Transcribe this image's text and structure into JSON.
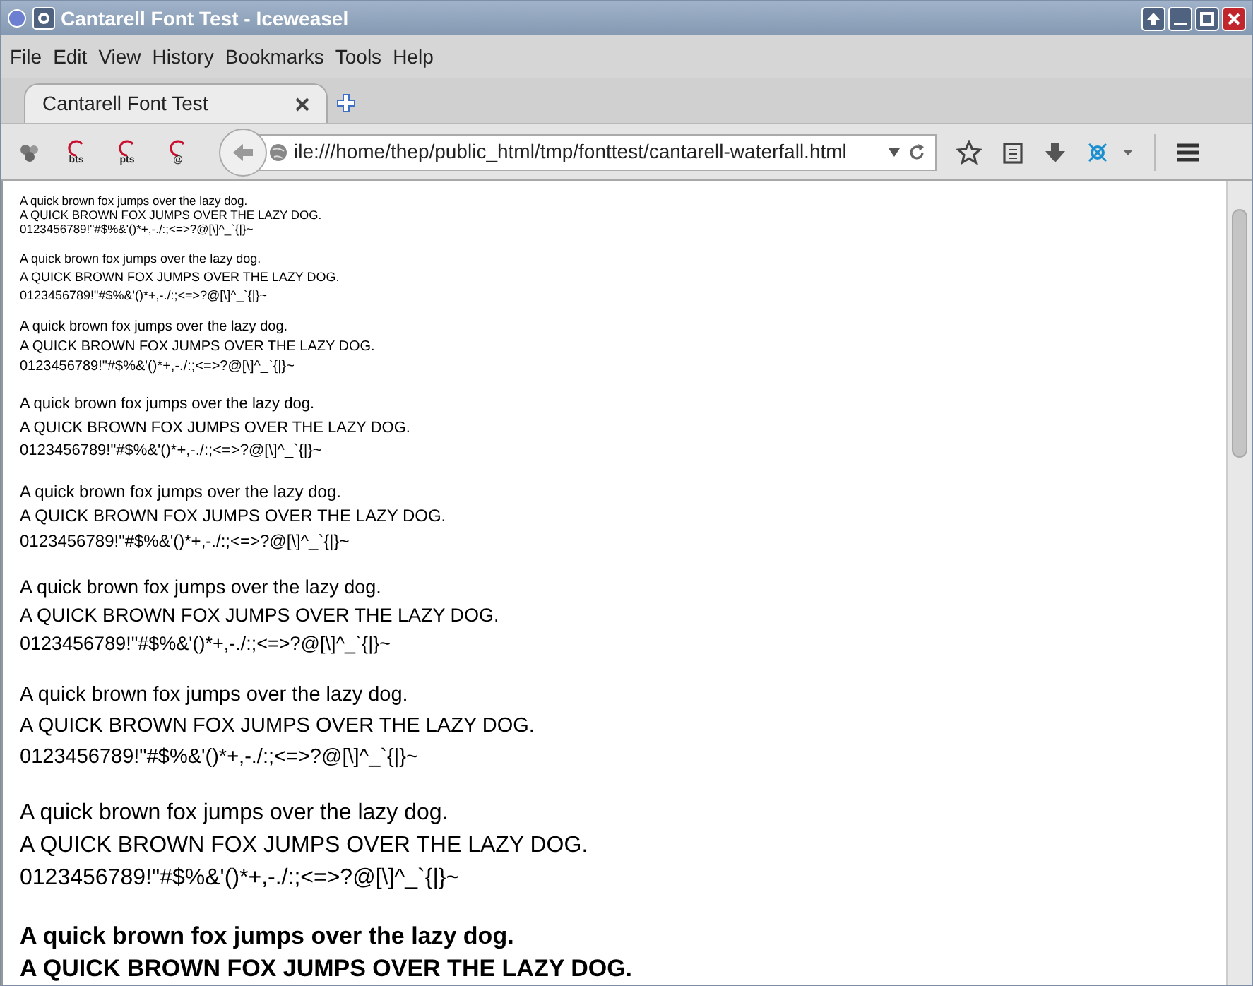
{
  "window": {
    "title": "Cantarell Font Test - Iceweasel"
  },
  "menu": [
    "File",
    "Edit",
    "View",
    "History",
    "Bookmarks",
    "Tools",
    "Help"
  ],
  "tabs": [
    {
      "label": "Cantarell Font Test",
      "selected": true
    }
  ],
  "bookmarks": [
    {
      "kind": "plain"
    },
    {
      "kind": "labeled",
      "label": "bts"
    },
    {
      "kind": "labeled",
      "label": "pts"
    },
    {
      "kind": "labeled",
      "label": "@"
    }
  ],
  "url": {
    "value": "ile:///home/thep/public_html/tmp/fonttest/cantarell-waterfall.html"
  },
  "blocks": [
    {
      "bold": false,
      "lines": [
        "A quick brown fox jumps over the lazy dog.",
        "A QUICK BROWN FOX JUMPS OVER THE LAZY DOG.",
        "0123456789!\"#$%&'()*+,-./:;<=>?@[\\]^_`{|}~"
      ]
    },
    {
      "bold": false,
      "lines": [
        "A quick brown fox jumps over the lazy dog.",
        "A QUICK BROWN FOX JUMPS OVER THE LAZY DOG.",
        "0123456789!\"#$%&'()*+,-./:;<=>?@[\\]^_`{|}~"
      ]
    },
    {
      "bold": false,
      "lines": [
        "A quick brown fox jumps over the lazy dog.",
        "A QUICK BROWN FOX JUMPS OVER THE LAZY DOG.",
        "0123456789!\"#$%&'()*+,-./:;<=>?@[\\]^_`{|}~"
      ]
    },
    {
      "bold": false,
      "lines": [
        "A quick brown fox jumps over the lazy dog.",
        "A QUICK BROWN FOX JUMPS OVER THE LAZY DOG.",
        "0123456789!\"#$%&'()*+,-./:;<=>?@[\\]^_`{|}~"
      ]
    },
    {
      "bold": false,
      "lines": [
        "A quick brown fox jumps over the lazy dog.",
        "A QUICK BROWN FOX JUMPS OVER THE LAZY DOG.",
        "0123456789!\"#$%&'()*+,-./:;<=>?@[\\]^_`{|}~"
      ]
    },
    {
      "bold": false,
      "lines": [
        "A quick brown fox jumps over the lazy dog.",
        "A QUICK BROWN FOX JUMPS OVER THE LAZY DOG.",
        "0123456789!\"#$%&'()*+,-./:;<=>?@[\\]^_`{|}~"
      ]
    },
    {
      "bold": false,
      "lines": [
        "A quick brown fox jumps over the lazy dog.",
        "A QUICK BROWN FOX JUMPS OVER THE LAZY DOG.",
        "0123456789!\"#$%&'()*+,-./:;<=>?@[\\]^_`{|}~"
      ]
    },
    {
      "bold": false,
      "lines": [
        "A quick brown fox jumps over the lazy dog.",
        "A QUICK BROWN FOX JUMPS OVER THE LAZY DOG.",
        "0123456789!\"#$%&'()*+,-./:;<=>?@[\\]^_`{|}~"
      ]
    },
    {
      "bold": true,
      "lines": [
        "A quick brown fox jumps over the lazy dog.",
        "A QUICK BROWN FOX JUMPS OVER THE LAZY DOG."
      ]
    }
  ]
}
